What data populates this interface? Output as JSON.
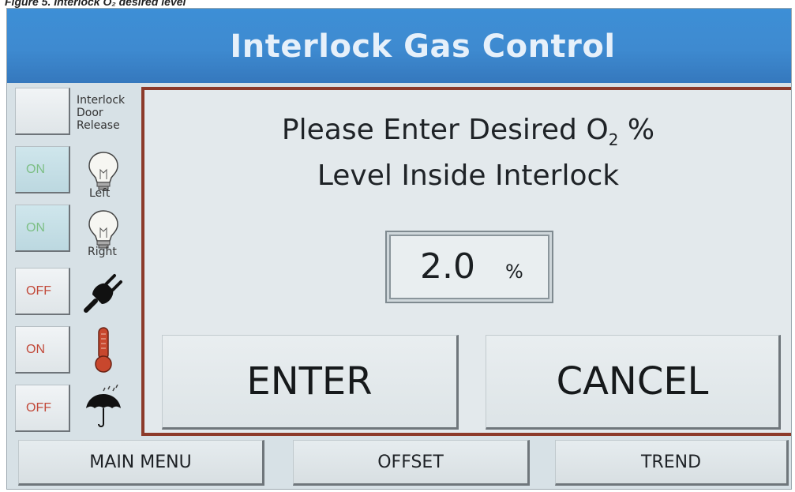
{
  "caption": "Figure 5. Interlock O₂ desired level",
  "header": {
    "title": "Interlock Gas Control"
  },
  "sidebar": {
    "door_release": {
      "label_lines": [
        "Interlock",
        "Door",
        "Release"
      ]
    },
    "items": [
      {
        "state": "ON",
        "label": "Left",
        "icon": "lightbulb-icon"
      },
      {
        "state": "ON",
        "label": "Right",
        "icon": "lightbulb-icon"
      },
      {
        "state": "OFF",
        "label": "",
        "icon": "power-plug-icon"
      },
      {
        "state": "ON",
        "label": "",
        "icon": "thermometer-icon"
      },
      {
        "state": "OFF",
        "label": "",
        "icon": "umbrella-rain-icon"
      }
    ]
  },
  "dialog": {
    "prompt_line1_prefix": "Please Enter Desired O",
    "prompt_subscript": "2",
    "prompt_line1_suffix": " %",
    "prompt_line2": "Level Inside Interlock",
    "value": "2.0",
    "unit": "%",
    "enter_label": "ENTER",
    "cancel_label": "CANCEL"
  },
  "footer": {
    "main_menu_label": "MAIN MENU",
    "offset_label": "OFFSET",
    "trend_label": "TREND"
  },
  "colors": {
    "header_blue": "#3e8ad0",
    "dialog_border": "#8c3a2a",
    "on_green": "#7dbf86",
    "off_red": "#c24a3a",
    "thermometer_red": "#c8472d"
  }
}
